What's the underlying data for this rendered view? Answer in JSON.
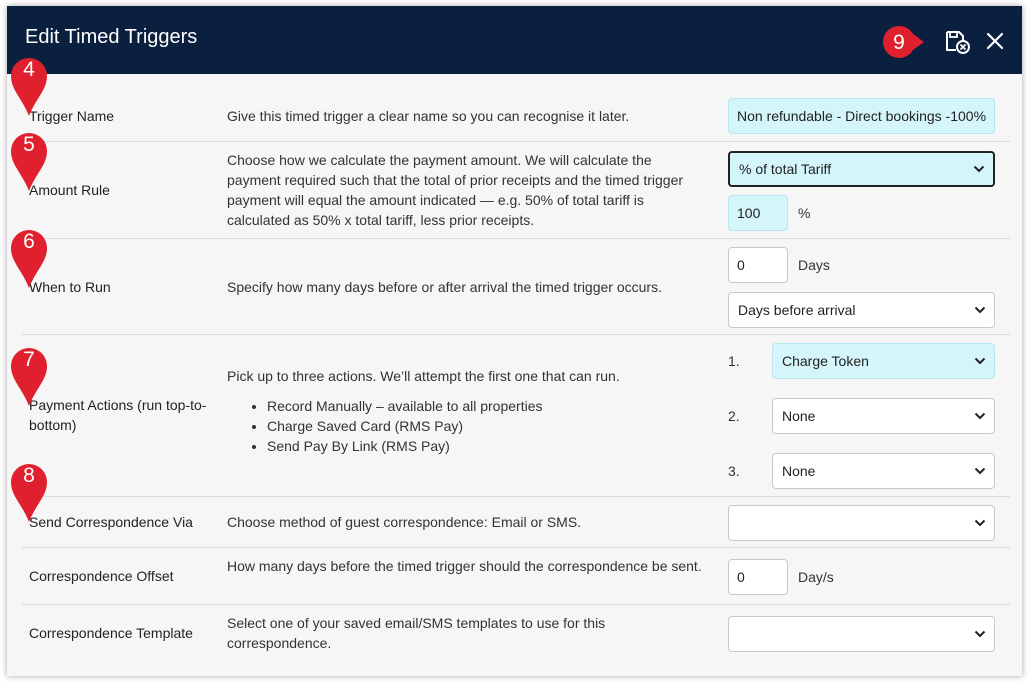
{
  "dialog": {
    "title": "Edit Timed Triggers",
    "save_icon": "save-close-icon",
    "close_icon": "close-icon"
  },
  "markers": [
    "4",
    "5",
    "6",
    "7",
    "8",
    "9"
  ],
  "rows": {
    "trigger_name": {
      "label": "Trigger Name",
      "description": "Give this timed trigger a clear name so you can recognise it later.",
      "value": "Non refundable - Direct bookings -100%"
    },
    "amount_rule": {
      "label": "Amount Rule",
      "description": "Choose how we calculate the payment amount. We will calculate the payment required such that the total of prior receipts and the timed trigger payment will equal the amount indicated — e.g. 50% of total tariff is calculated as 50% x total tariff, less prior receipts.",
      "selected": "% of total Tariff",
      "amount": "100",
      "amount_suffix": "%"
    },
    "when_to_run": {
      "label": "When to Run",
      "description": "Specify how many days before or after arrival the timed trigger occurs.",
      "days": "0",
      "days_suffix": "Days",
      "selected": "Days before arrival"
    },
    "payment_actions": {
      "label": "Payment Actions (run top-to-bottom)",
      "description": "Pick up to three actions. We’ll attempt the first one that can run.",
      "bullets": [
        "Record Manually – available to all properties",
        "Charge Saved Card (RMS Pay)",
        "Send Pay By Link (RMS Pay)"
      ],
      "actions": [
        {
          "num": "1.",
          "selected": "Charge Token"
        },
        {
          "num": "2.",
          "selected": "None"
        },
        {
          "num": "3.",
          "selected": "None"
        }
      ]
    },
    "send_correspondence": {
      "label": "Send Correspondence Via",
      "description": "Choose method of guest correspondence: Email or SMS.",
      "selected": ""
    },
    "correspondence_offset": {
      "label": "Correspondence Offset",
      "description": "How many days before the timed trigger should the correspondence be sent.",
      "value": "0",
      "suffix": "Day/s"
    },
    "correspondence_template": {
      "label": "Correspondence Template",
      "description": "Select one of your saved email/SMS templates to use for this correspondence.",
      "selected": ""
    }
  },
  "colors": {
    "header_bg": "#0b1f3f",
    "marker_red": "#e0202e",
    "highlight_cyan": "#d4f5f9"
  }
}
